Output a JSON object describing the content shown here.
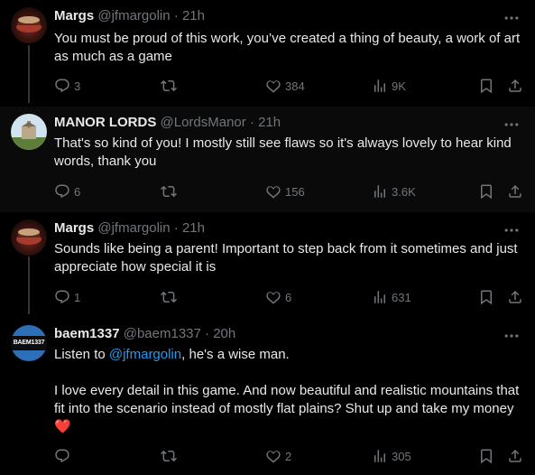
{
  "tweets": [
    {
      "name": "Margs",
      "handle": "@jfmargolin",
      "separator": "·",
      "time": "21h",
      "lines": [
        "You must be proud of this work, you’ve created a thing of beauty, a work of art as much as a game"
      ],
      "replies": "3",
      "retweets": "",
      "likes": "384",
      "views": "9K"
    },
    {
      "name": "MANOR LORDS",
      "handle": "@LordsManor",
      "separator": "·",
      "time": "21h",
      "lines": [
        "That's so kind of you! I mostly still see flaws so it's always lovely to hear kind words, thank you"
      ],
      "replies": "6",
      "retweets": "",
      "likes": "156",
      "views": "3.6K"
    },
    {
      "name": "Margs",
      "handle": "@jfmargolin",
      "separator": "·",
      "time": "21h",
      "lines": [
        "Sounds like being a parent! Important to step back from it sometimes and just appreciate how special it is"
      ],
      "replies": "1",
      "retweets": "",
      "likes": "6",
      "views": "631"
    },
    {
      "name": "baem1337",
      "handle": "@baem1337",
      "separator": "·",
      "time": "20h",
      "intro_prefix": "Listen to ",
      "intro_mention": "@jfmargolin",
      "intro_suffix": ", he's a wise man.",
      "body": "I love every detail in this game. And now beautiful and realistic mountains that fit into the scenario instead of mostly flat plains? Shut up and take my money",
      "emoji": "❤️",
      "avatar_text": "BAEM1337",
      "replies": "",
      "retweets": "",
      "likes": "2",
      "views": "305"
    }
  ],
  "icons": [
    "reply-icon",
    "retweet-icon",
    "like-icon",
    "views-icon",
    "bookmark-icon",
    "share-icon",
    "more-icon"
  ],
  "colors": {
    "background": "#000000",
    "text": "#e7e9ea",
    "muted": "#71767b",
    "link": "#1d9bf0",
    "heart": "#f91880"
  }
}
